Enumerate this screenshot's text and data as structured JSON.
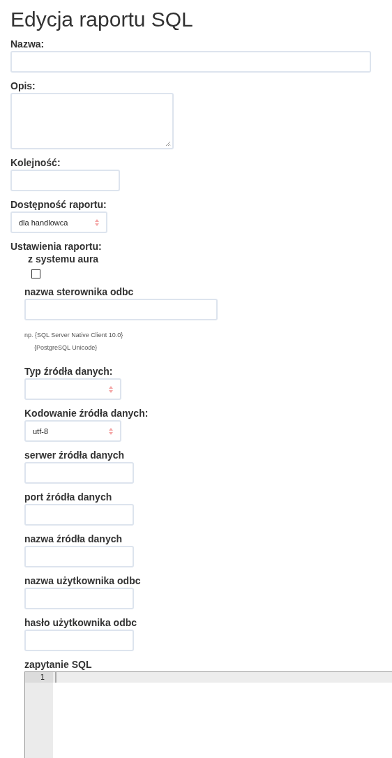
{
  "title": "Edycja raportu SQL",
  "fields": [
    {
      "kind": "wide",
      "label": "Nazwa:"
    },
    {
      "kind": "textarea",
      "label": "Opis:"
    },
    {
      "kind": "short",
      "label": "Kolejność:"
    },
    {
      "kind": "select",
      "label": "Dostępność raportu:",
      "value": "dla handlowca"
    }
  ],
  "settings": {
    "label": "Ustawienia raportu:",
    "items": [
      {
        "kind": "checkbox",
        "label": "z systemu aura",
        "checked": false
      },
      {
        "kind": "wide",
        "label": "nazwa sterownika odbc",
        "hints": [
          "np. {SQL Server Native Client 10.0}",
          "{PostgreSQL Unicode}"
        ]
      },
      {
        "kind": "select",
        "label": "Typ źródła danych:"
      },
      {
        "kind": "select",
        "label": "Kodowanie źródła danych:",
        "value": "utf-8"
      },
      {
        "kind": "short",
        "label": "serwer źródła danych"
      },
      {
        "kind": "short",
        "label": "port źródła danych"
      },
      {
        "kind": "short",
        "label": "nazwa źródła danych"
      },
      {
        "kind": "short",
        "label": "nazwa użytkownika odbc"
      },
      {
        "kind": "short",
        "label": "hasło użytkownika odbc"
      },
      {
        "kind": "editor",
        "label": "zapytanie SQL",
        "lines": [
          "1"
        ]
      }
    ]
  }
}
